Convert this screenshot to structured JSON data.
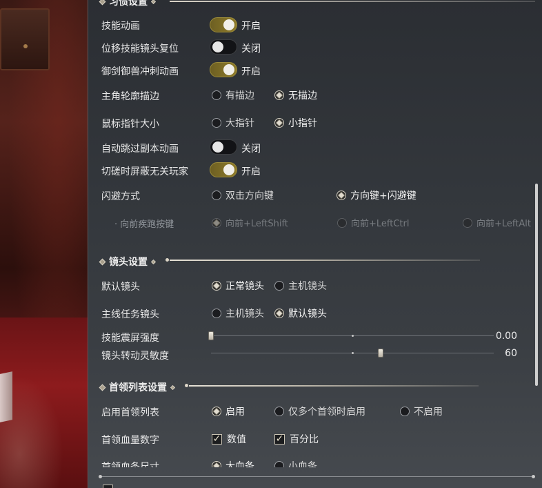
{
  "sections": {
    "operation": {
      "title": "习惯设置"
    },
    "camera": {
      "title": "镜头设置"
    },
    "boss_list": {
      "title": "首领列表设置"
    }
  },
  "rows": {
    "skill_anim": {
      "label": "技能动画",
      "state": "开启",
      "on": true
    },
    "move_skill_reset": {
      "label": "位移技能镜头复位",
      "state": "关闭",
      "on": false
    },
    "sword_dash_anim": {
      "label": "御剑御兽冲刺动画",
      "state": "开启",
      "on": true
    },
    "outline": {
      "label": "主角轮廓描边",
      "options": [
        "有描边",
        "无描边"
      ],
      "selected": "无描边"
    },
    "pointer_size": {
      "label": "鼠标指针大小",
      "options": [
        "大指针",
        "小指针"
      ],
      "selected": "小指针"
    },
    "skip_dungeon_anim": {
      "label": "自动跳过副本动画",
      "state": "关闭",
      "on": false
    },
    "hide_players": {
      "label": "切磋时屏蔽无关玩家",
      "state": "开启",
      "on": true
    },
    "dodge_mode": {
      "label": "闪避方式",
      "options": [
        "双击方向键",
        "方向键+闪避键"
      ],
      "selected": "方向键+闪避键"
    },
    "sprint_key": {
      "label": "向前疾跑按键",
      "options": [
        "向前+LeftShift",
        "向前+LeftCtrl",
        "向前+LeftAlt"
      ],
      "selected": "向前+LeftShift",
      "disabled": true
    },
    "default_camera": {
      "label": "默认镜头",
      "options": [
        "正常镜头",
        "主机镜头"
      ],
      "selected": "正常镜头"
    },
    "quest_camera": {
      "label": "主线任务镜头",
      "options": [
        "主机镜头",
        "默认镜头"
      ],
      "selected": "默认镜头"
    },
    "shake": {
      "label": "技能震屏强度",
      "value": "0.00",
      "level": 0.0
    },
    "sensitivity": {
      "label": "镜头转动灵敏度",
      "value": "60",
      "level": 0.6
    },
    "enable_boss_list": {
      "label": "启用首领列表",
      "options": [
        "启用",
        "仅多个首领时启用",
        "不启用"
      ],
      "selected": "启用"
    },
    "boss_hp_number": {
      "label": "首领血量数字",
      "checks": [
        "数值",
        "百分比"
      ]
    },
    "boss_bar_size": {
      "label": "首领血条尺寸",
      "options": [
        "大血条",
        "小血条"
      ],
      "selected": "大血条"
    }
  },
  "colors": {
    "toggle_on": "#8f7c2a",
    "panel": "#33373c",
    "text": "#e8e8e8"
  },
  "icons": {
    "radio_selected": "diamond-dot-icon",
    "checkbox": "check-icon"
  }
}
